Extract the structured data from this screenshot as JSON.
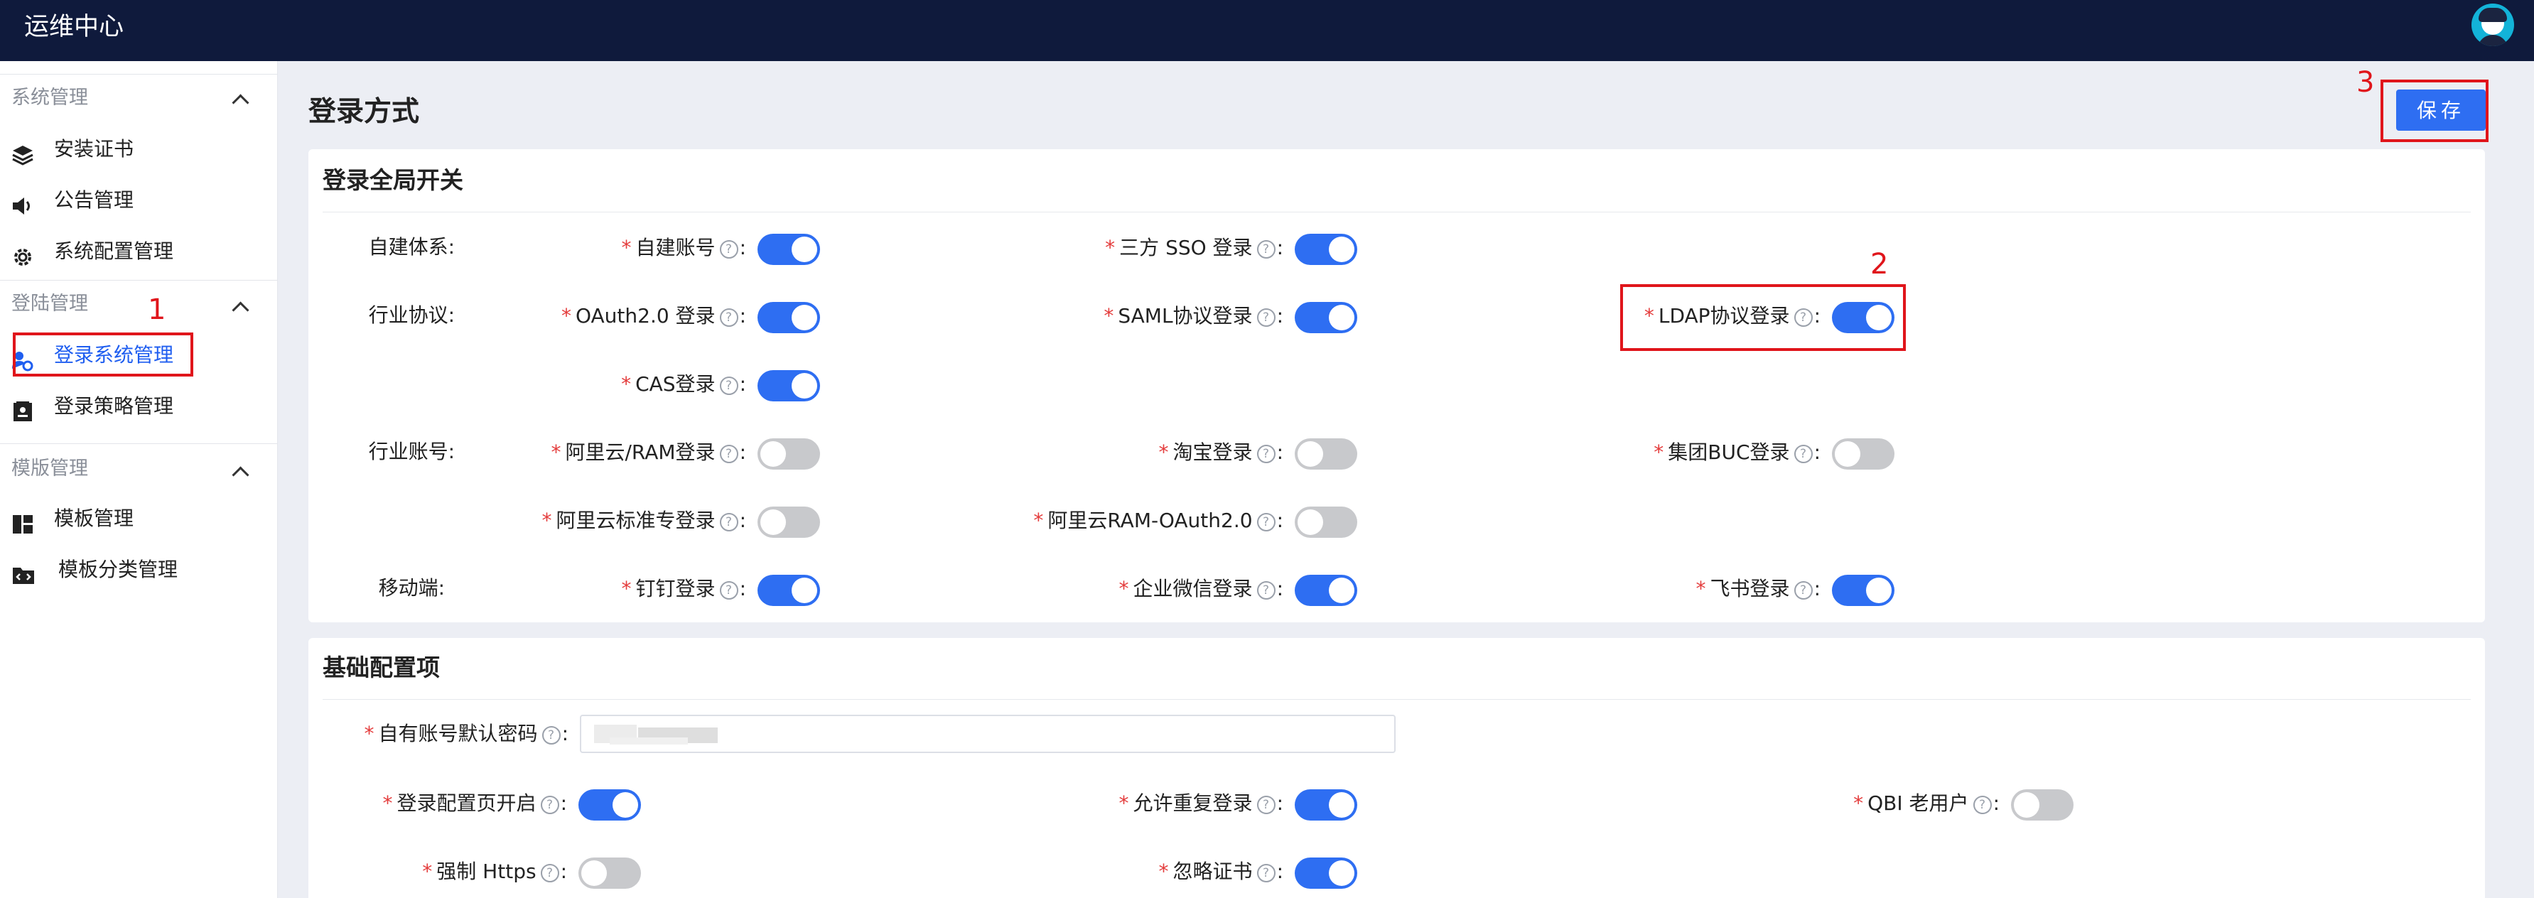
{
  "app_title": "运维中心",
  "sidebar": {
    "groups": [
      {
        "label": "系统管理",
        "items": [
          {
            "label": "安装证书"
          },
          {
            "label": "公告管理"
          },
          {
            "label": "系统配置管理"
          }
        ]
      },
      {
        "label": "登陆管理",
        "items": [
          {
            "label": "登录系统管理"
          },
          {
            "label": "登录策略管理"
          }
        ]
      },
      {
        "label": "模版管理",
        "items": [
          {
            "label": "模板管理"
          },
          {
            "label": "模板分类管理"
          }
        ]
      }
    ],
    "active_item": "登录系统管理"
  },
  "page_title": "登录方式",
  "save_label": "保存",
  "annotations": [
    "1",
    "2",
    "3"
  ],
  "card1": {
    "title": "登录全局开关",
    "row_labels": [
      "自建体系:",
      "行业协议:",
      "行业账号:",
      "移动端:"
    ],
    "fields": [
      {
        "label": "自建账号",
        "on": true
      },
      {
        "label": "三方 SSO 登录",
        "on": true
      },
      {
        "label": "OAuth2.0 登录",
        "on": true
      },
      {
        "label": "SAML协议登录",
        "on": true
      },
      {
        "label": "LDAP协议登录",
        "on": true
      },
      {
        "label": "CAS登录",
        "on": true
      },
      {
        "label": "阿里云/RAM登录",
        "on": false
      },
      {
        "label": "淘宝登录",
        "on": false
      },
      {
        "label": "集团BUC登录",
        "on": false
      },
      {
        "label": "阿里云标准专登录",
        "on": false
      },
      {
        "label": "阿里云RAM-OAuth2.0",
        "on": false
      },
      {
        "label": "钉钉登录",
        "on": true
      },
      {
        "label": "企业微信登录",
        "on": true
      },
      {
        "label": "飞书登录",
        "on": true
      }
    ]
  },
  "card2": {
    "title": "基础配置项",
    "password_label": "自有账号默认密码",
    "fields": [
      {
        "label": "登录配置页开启",
        "on": true
      },
      {
        "label": "允许重复登录",
        "on": true
      },
      {
        "label": "QBI 老用户",
        "on": false
      },
      {
        "label": "强制 Https",
        "on": false
      },
      {
        "label": "忽略证书",
        "on": true
      }
    ]
  },
  "help_glyph": "?",
  "required_mark": "*",
  "colors": {
    "topbar": "#0f1a3c",
    "accent": "#2e6ef2",
    "annotation": "#e0151b",
    "toggle_off": "#c8c9cc"
  }
}
